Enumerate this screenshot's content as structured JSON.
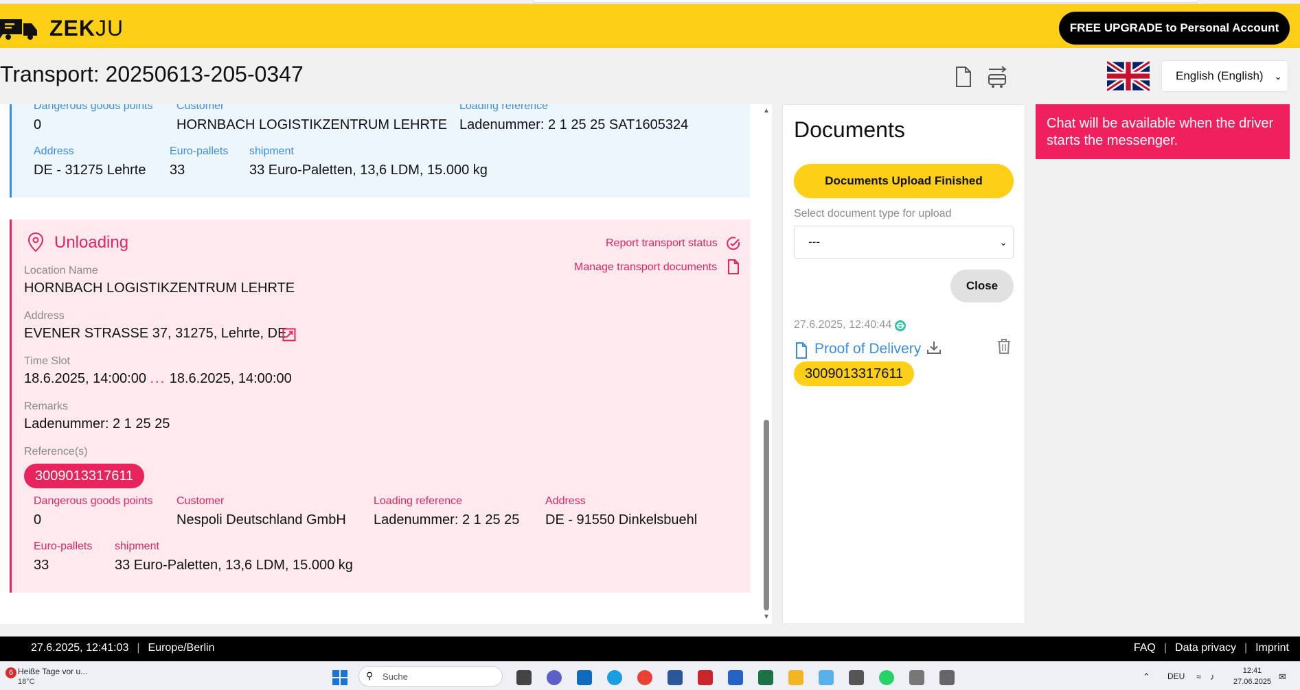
{
  "header": {
    "brand_bold": "ZEK",
    "brand_light": "JU",
    "upgrade_label": "FREE UPGRADE to Personal Account"
  },
  "title_bar": {
    "title": "Transport: 20250613-205-0347",
    "language": "English (English)"
  },
  "loading": {
    "labels": {
      "dangerous_goods": "Dangerous goods points",
      "customer": "Customer",
      "loading_reference": "Loading reference",
      "address": "Address",
      "euro_pallets": "Euro-pallets",
      "shipment": "shipment"
    },
    "dangerous_goods": "0",
    "customer": "HORNBACH LOGISTIKZENTRUM LEHRTE",
    "loading_reference": "Ladenummer: 2 1 25 25 SAT1605324",
    "address": "DE - 31275 Lehrte",
    "euro_pallets": "33",
    "shipment": "33 Euro-Paletten, 13,6 LDM, 15.000 kg"
  },
  "unloading": {
    "title": "Unloading",
    "report_status": "Report transport status",
    "manage_docs": "Manage transport documents",
    "location_label": "Location Name",
    "location": "HORNBACH LOGISTIKZENTRUM LEHRTE",
    "address_label": "Address",
    "address": "EVENER STRASSE 37, 31275, Lehrte, DE",
    "timeslot_label": "Time Slot",
    "timeslot_from": "18.6.2025, 14:00:00",
    "timeslot_sep": "...",
    "timeslot_to": "18.6.2025, 14:00:00",
    "remarks_label": "Remarks",
    "remarks": "Ladenummer: 2 1 25 25",
    "references_label": "Reference(s)",
    "reference": "3009013317611",
    "labels": {
      "dangerous_goods": "Dangerous goods points",
      "customer": "Customer",
      "loading_reference": "Loading reference",
      "address": "Address",
      "euro_pallets": "Euro-pallets",
      "shipment": "shipment"
    },
    "dangerous_goods": "0",
    "customer": "Nespoli Deutschland GmbH",
    "loading_reference": "Ladenummer: 2 1 25 25",
    "detail_address": "DE - 91550 Dinkelsbuehl",
    "euro_pallets": "33",
    "shipment": "33 Euro-Paletten, 13,6 LDM, 15.000 kg"
  },
  "documents": {
    "title": "Documents",
    "upload_finished": "Documents Upload Finished",
    "select_label": "Select document type for upload",
    "select_value": "---",
    "close": "Close",
    "items": [
      {
        "timestamp": "27.6.2025, 12:40:44",
        "name": "Proof of Delivery",
        "reference": "3009013317611"
      }
    ]
  },
  "chat": {
    "notice": "Chat will be available when the driver starts the messenger."
  },
  "footer": {
    "datetime": "27.6.2025, 12:41:03",
    "timezone": "Europe/Berlin",
    "faq": "FAQ",
    "privacy": "Data privacy",
    "imprint": "Imprint"
  },
  "taskbar": {
    "weather_badge": "6",
    "weather_title": "Heiße Tage vor u...",
    "weather_temp": "18°C",
    "search_placeholder": "Suche",
    "lang": "DEU",
    "time": "12:41",
    "date": "27.06.2025"
  },
  "colors": {
    "brand_yellow": "#fdcf16",
    "accent_pink": "#e8245c",
    "accent_blue": "#3b8de0"
  }
}
